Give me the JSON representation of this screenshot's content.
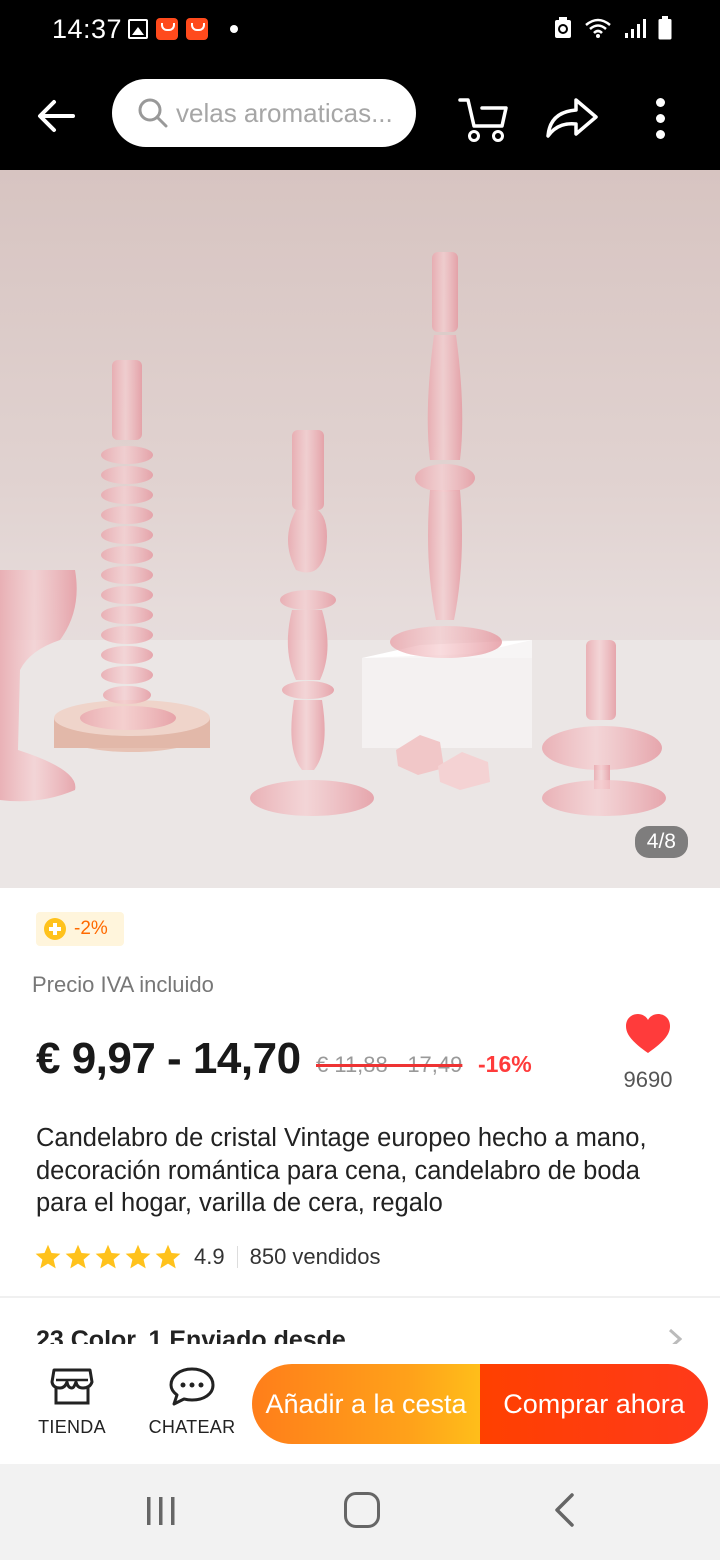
{
  "status_bar": {
    "time": "14:37"
  },
  "search": {
    "placeholder": "velas aromaticas..."
  },
  "image": {
    "counter": "4/8"
  },
  "product": {
    "badge": "-2%",
    "tax_note": "Precio IVA incluido",
    "price": "€ 9,97 - 14,70",
    "original_price": "€ 11,88 - 17,49",
    "discount": "-16%",
    "wishlist_count": "9690",
    "title": "Candelabro de cristal Vintage europeo hecho a mano, decoración romántica para cena, candelabro de boda para el hogar, varilla de cera, regalo",
    "rating": "4.9",
    "stars": 5,
    "sold": "850 vendidos",
    "options_summary": "23 Color, 1 Enviado desde"
  },
  "actions": {
    "store_label": "TIENDA",
    "chat_label": "CHATEAR",
    "add_to_cart": "Añadir a la cesta",
    "buy_now": "Comprar ahora"
  },
  "colors": {
    "accent_orange": "#ff8a1a",
    "buy_red": "#ff3d00",
    "price_discount": "#ff3b3b",
    "heart": "#ff3b3b",
    "star": "#ffc21c"
  },
  "icons": [
    "back-arrow-icon",
    "search-icon",
    "cart-icon",
    "share-icon",
    "more-icon",
    "heart-icon",
    "star-icon",
    "coin-icon",
    "store-icon",
    "chat-icon",
    "chevron-right-icon"
  ]
}
